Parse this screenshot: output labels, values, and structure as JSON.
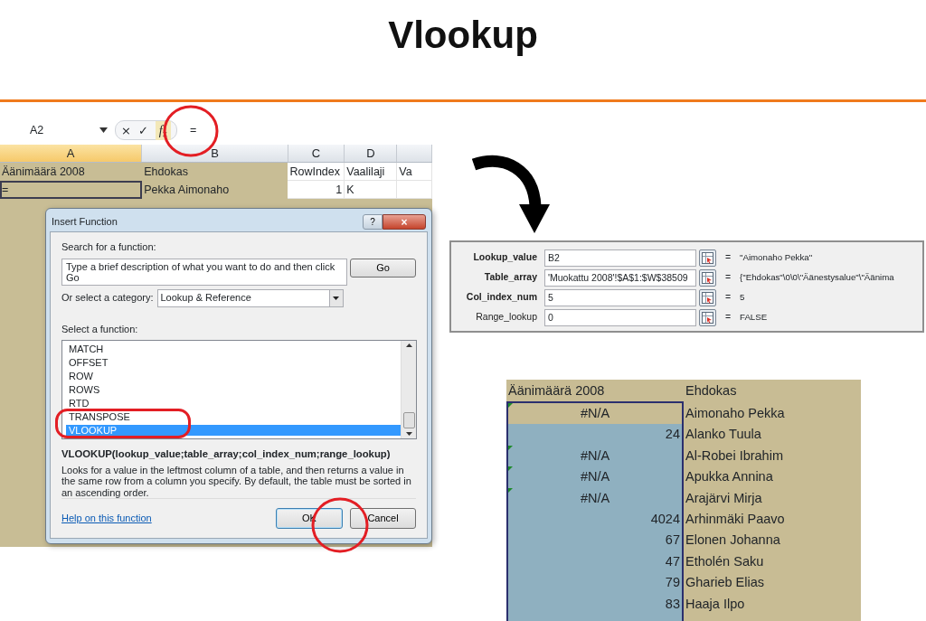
{
  "title": "Vlookup",
  "spreadsheet": {
    "name_box": "A2",
    "formula_buttons": [
      "×",
      "✓"
    ],
    "fx_button": "*f*$_{x}$",
    "formula": "=",
    "columns": [
      {
        "label": "A",
        "selected": true,
        "shaded": true
      },
      {
        "label": "B",
        "selected": false,
        "shaded": true
      },
      {
        "label": "C",
        "selected": false,
        "shaded": false
      },
      {
        "label": "D",
        "selected": false,
        "shaded": false
      },
      {
        "selected": false,
        "shaded": false
      }
    ],
    "rows": [
      {
        "cells": [
          {
            "text": "Äänimäärä 2008",
            "active": false,
            "numeric": false
          },
          {
            "text": "Ehdokas",
            "active": false,
            "numeric": false
          },
          {
            "text": "RowIndex",
            "active": false,
            "numeric": false
          },
          {
            "text": "Vaalilaji",
            "active": false,
            "numeric": false
          },
          {
            "text": "Va",
            "active": false,
            "numeric": false
          }
        ]
      },
      {
        "cells": [
          {
            "text": "=",
            "active": true,
            "numeric": false
          },
          {
            "text": "Pekka Aimonaho",
            "active": false,
            "numeric": false
          },
          {
            "text": "1",
            "active": false,
            "numeric": true
          },
          {
            "text": "K",
            "active": false,
            "numeric": false
          }
        ]
      }
    ]
  },
  "dialog": {
    "title": "Insert Function",
    "help_button": "?",
    "close_button": "×",
    "search_label": "Search for a function:",
    "search_value": "Type a brief description of what you want to do and then click Go",
    "go_button": "Go",
    "category_label": "Or select a category:",
    "category_value": "Lookup & Reference",
    "list_label": "Select a function:",
    "functions": [
      {
        "label": "MATCH",
        "selected": false
      },
      {
        "label": "OFFSET",
        "selected": false
      },
      {
        "label": "ROW",
        "selected": false
      },
      {
        "label": "ROWS",
        "selected": false
      },
      {
        "label": "RTD",
        "selected": false
      },
      {
        "label": "TRANSPOSE",
        "selected": false
      },
      {
        "label": "VLOOKUP",
        "selected": true
      }
    ],
    "signature": "VLOOKUP(lookup_value;table_array;col_index_num;range_lookup)",
    "description": "Looks for a value in the leftmost column of a table, and then returns a value in the same row from a column you specify. By default, the table must be sorted in an ascending order.",
    "help_link": "Help on this function",
    "buttons": [
      {
        "label": "OK",
        "default": true
      },
      {
        "label": "Cancel",
        "default": false
      }
    ]
  },
  "arguments": [
    {
      "label": "Lookup_value",
      "required": true,
      "value": "B2",
      "equals": "=",
      "result": "\"Aimonaho Pekka\""
    },
    {
      "label": "Table_array",
      "required": true,
      "value": "'Muokattu 2008'!$A$1:$W$38509",
      "equals": "=",
      "result": "{\"Ehdokas\"\\0\\0\\\"Äänestysalue\"\\\"Äänima"
    },
    {
      "label": "Col_index_num",
      "required": true,
      "value": "5",
      "equals": "=",
      "result": "5"
    },
    {
      "label": "Range_lookup",
      "required": false,
      "value": "0",
      "equals": "=",
      "result": "FALSE"
    }
  ],
  "result_table": {
    "columns": [
      "Äänimäärä 2008",
      "Ehdokas"
    ],
    "rows": [
      {
        "value": "#N/A",
        "name": "Aimonaho Pekka",
        "error": true,
        "active": true
      },
      {
        "value": "24",
        "name": "Alanko Tuula",
        "error": false,
        "active": false
      },
      {
        "value": "#N/A",
        "name": "Al-Robei Ibrahim",
        "error": true,
        "active": false
      },
      {
        "value": "#N/A",
        "name": "Apukka Annina",
        "error": true,
        "active": false
      },
      {
        "value": "#N/A",
        "name": "Arajärvi Mirja",
        "error": true,
        "active": false
      },
      {
        "value": "4024",
        "name": "Arhinmäki Paavo",
        "error": false,
        "active": false
      },
      {
        "value": "67",
        "name": "Elonen Johanna",
        "error": false,
        "active": false
      },
      {
        "value": "47",
        "name": "Etholén Saku",
        "error": false,
        "active": false
      },
      {
        "value": "79",
        "name": "Gharieb Elias",
        "error": false,
        "active": false
      },
      {
        "value": "83",
        "name": "Haaja Ilpo",
        "error": false,
        "active": false
      }
    ]
  }
}
